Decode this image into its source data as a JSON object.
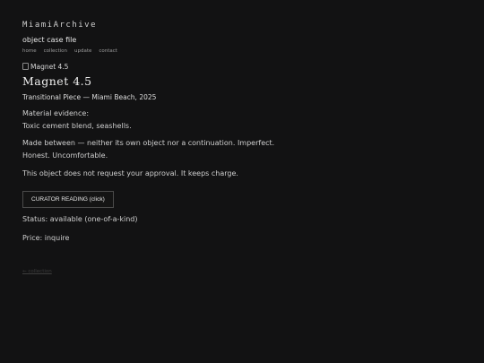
{
  "site": {
    "title": "MiamiArchive",
    "subtitle": "object case file"
  },
  "nav": {
    "items": [
      "home",
      "collection",
      "update",
      "contact"
    ]
  },
  "object": {
    "image_alt": "Magnet 4.5",
    "title": "Magnet 4.5",
    "meta": "Transitional Piece — Miami Beach, 2025",
    "evidence_label": "Material evidence:",
    "evidence_text": "Toxic cement blend, seashells.",
    "description_line1": "Made between — neither its own object nor a continuation. Imperfect.",
    "description_line2": "Honest. Uncomfortable.",
    "approval_text": "This object does not request your approval. It keeps charge.",
    "curator_button_label": "CURATOR READING (click)",
    "status": "Status: available (one-of-a-kind)",
    "price": "Price: inquire"
  },
  "footer": {
    "back_link": "← collection"
  },
  "colors": {
    "background": "#121213",
    "text": "#d8d8d8",
    "muted_link": "#9a9a9a",
    "button_border": "#4a4a4a"
  },
  "icons": {
    "image_placeholder": "broken-image-icon"
  }
}
